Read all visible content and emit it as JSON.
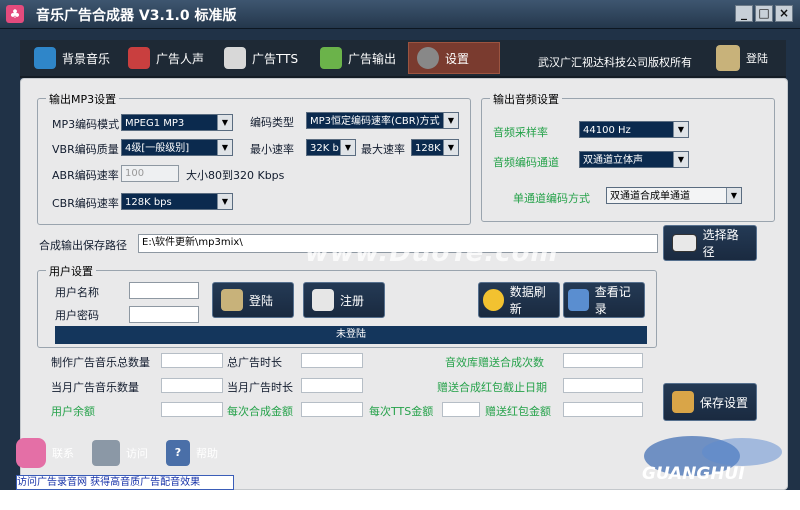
{
  "window": {
    "title": "音乐广告合成器  V3.1.0 标准版",
    "controls": [
      "_",
      "□",
      "×"
    ]
  },
  "tabs": [
    {
      "label": "背景音乐",
      "icon": "music-folder-icon",
      "color": "#2f86c9"
    },
    {
      "label": "广告人声",
      "icon": "voice-icon",
      "color": "#c93f3f"
    },
    {
      "label": "广告TTS",
      "icon": "tts-document-icon",
      "color": "#d8d8d8"
    },
    {
      "label": "广告输出",
      "icon": "output-blocks-icon",
      "color": "#6bb34a"
    },
    {
      "label": "设置",
      "icon": "gear-icon",
      "color": "#888888",
      "active": true
    }
  ],
  "header": {
    "copyright": "武汉广汇视达科技公司版权所有",
    "login_label": "登陆"
  },
  "mp3_settings": {
    "group_title": "输出MP3设置",
    "mode_label": "MP3编码模式",
    "mode_value": "MPEG1 MP3",
    "encode_type_label": "编码类型",
    "encode_type_value": "MP3恒定编码速率(CBR)方式",
    "vbr_quality_label": "VBR编码质量",
    "vbr_quality_value": "4级[一般级别]",
    "min_rate_label": "最小速率",
    "min_rate_value": "32K b",
    "max_rate_label": "最大速率",
    "max_rate_value": "128K",
    "abr_label": "ABR编码速率",
    "abr_value": "100",
    "abr_hint": "大小80到320 Kbps",
    "cbr_label": "CBR编码速率",
    "cbr_value": "128K bps"
  },
  "audio_settings": {
    "group_title": "输出音频设置",
    "sample_rate_label": "音频采样率",
    "sample_rate_value": "44100 Hz",
    "channel_label": "音频编码通道",
    "channel_value": "双通道立体声",
    "mono_label": "单通道编码方式",
    "mono_value": "双通道合成单通道"
  },
  "output_path": {
    "label": "合成输出保存路径",
    "value": "E:\\软件更新\\mp3mix\\",
    "button": "选择路径",
    "button_icon": "mp3-folder-icon"
  },
  "user_settings": {
    "group_title": "用户设置",
    "username_label": "用户名称",
    "password_label": "用户密码",
    "login_button": "登陆",
    "register_button": "注册",
    "refresh_button": "数据刷新",
    "records_button": "查看记录",
    "status": "未登陆"
  },
  "stats": {
    "total_count_label": "制作广告音乐总数量",
    "total_duration_label": "总广告时长",
    "db_gift_label": "音效库赠送合成次数",
    "month_count_label": "当月广告音乐数量",
    "month_duration_label": "当月广告时长",
    "gift_expire_label": "赠送合成红包截止日期",
    "balance_label": "用户余额",
    "per_amount_label": "每次合成金额",
    "per_tts_label": "每次TTS金额",
    "gift_amount_label": "赠送红包金额"
  },
  "save_button": "保存设置",
  "footer": {
    "contact": "联系",
    "visit": "访问",
    "help": "帮助",
    "scroll_text": "访问广告录音网  获得高音质广告配音效果"
  },
  "watermark": "www.DuoTe.com",
  "logo_text": "GUANGHUI"
}
